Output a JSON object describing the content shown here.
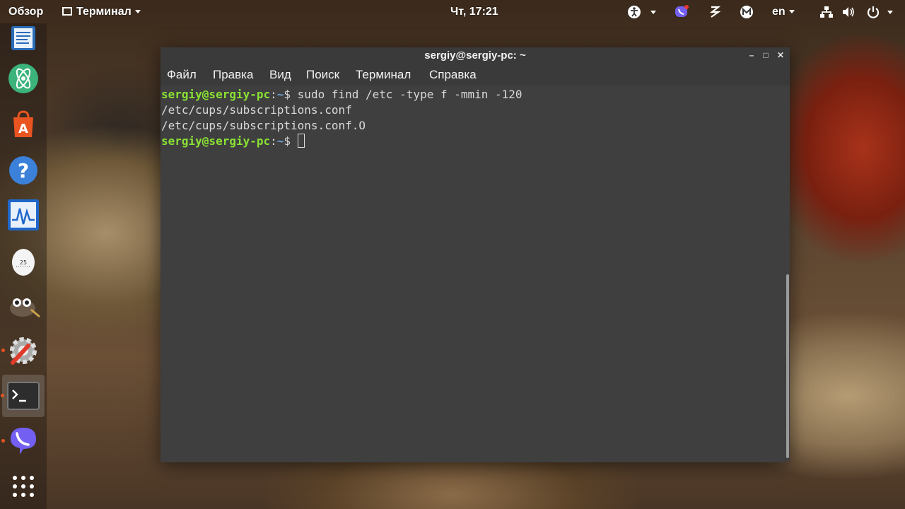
{
  "topbar": {
    "activities_label": "Обзор",
    "app_menu_label": "Терминал",
    "clock": "Чт, 17:21",
    "language": "en",
    "tray_icons": [
      "accessibility-icon",
      "viber-tray-icon",
      "zeal-icon",
      "mail-icon",
      "network-icon",
      "volume-icon",
      "power-icon"
    ]
  },
  "dock": {
    "items": [
      "text-editor-icon",
      "atom-icon",
      "software-center-icon",
      "help-icon",
      "system-monitor-icon",
      "timer-icon",
      "gimp-icon",
      "settings-icon",
      "terminal-icon",
      "viber-icon",
      "app-grid-icon"
    ],
    "active_item": "terminal-icon"
  },
  "terminal": {
    "title": "sergiy@sergiy-pc: ~",
    "menu": [
      "Файл",
      "Правка",
      "Вид",
      "Поиск",
      "Терминал",
      "Справка"
    ],
    "prompt_user": "sergiy@sergiy-pc",
    "prompt_sep": ":",
    "prompt_path": "~",
    "prompt_symbol": "$ ",
    "command": "sudo find /etc -type f -mmin -120",
    "output": [
      "/etc/cups/subscriptions.conf",
      "/etc/cups/subscriptions.conf.O"
    ],
    "colors": {
      "user": "#8ae234",
      "path": "#729fcf",
      "background": "#3f3f3f"
    }
  }
}
